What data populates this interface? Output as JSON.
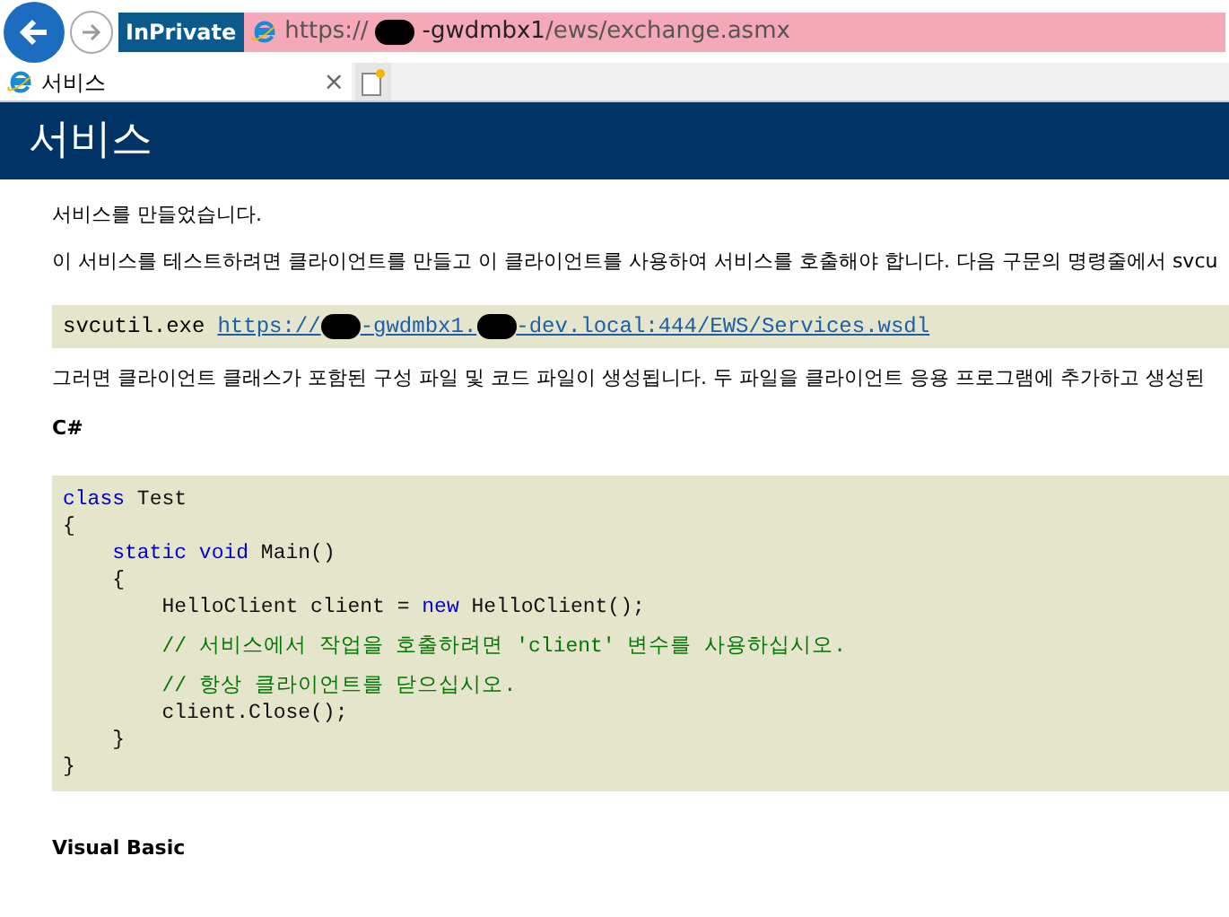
{
  "browser": {
    "inprivate_label": "InPrivate",
    "address": {
      "prefix": "https://",
      "suffix": "-gwdmbx1",
      "path": "/ews/exchange.asmx"
    },
    "tab": {
      "title": "서비스",
      "close": "×"
    }
  },
  "header": {
    "title": "서비스"
  },
  "intro": [
    "서비스를 만들었습니다.",
    "이 서비스를 테스트하려면 클라이언트를 만들고 이 클라이언트를 사용하여 서비스를 호출해야 합니다. 다음 구문의 명령줄에서 svcu"
  ],
  "command": {
    "program": "svcutil.exe",
    "link_parts": [
      "https://",
      "-gwdmbx1.",
      "-dev.local:444/EWS/Services.wsdl"
    ]
  },
  "after": "그러면 클라이언트 클래스가 포함된 구성 파일 및 코드 파일이 생성됩니다. 두 파일을 클라이언트 응용 프로그램에 추가하고 생성된",
  "csharp_heading": "C#",
  "code": [
    [
      {
        "kind": "keyword",
        "text": "class"
      },
      {
        "kind": "plain",
        "text": " Test"
      }
    ],
    [
      {
        "kind": "plain",
        "text": "{"
      }
    ],
    [
      {
        "kind": "keyword",
        "text": "    static"
      },
      {
        "kind": "keyword",
        "text": " void"
      },
      {
        "kind": "plain",
        "text": " Main()"
      }
    ],
    [
      {
        "kind": "plain",
        "text": "    {"
      }
    ],
    [
      {
        "kind": "plain",
        "text": "        HelloClient client = "
      },
      {
        "kind": "keyword",
        "text": "new"
      },
      {
        "kind": "plain",
        "text": " HelloClient();"
      }
    ],
    [
      {
        "kind": "comment",
        "text": "        // 서비스에서 작업을 호출하려면 'client' 변수를 사용하십시오."
      }
    ],
    [
      {
        "kind": "comment",
        "text": "        // 항상 클라이언트를 닫으십시오."
      }
    ],
    [
      {
        "kind": "plain",
        "text": "        client.Close();"
      }
    ],
    [
      {
        "kind": "plain",
        "text": "    }"
      }
    ],
    [
      {
        "kind": "plain",
        "text": "}"
      }
    ]
  ],
  "vb_heading": "Visual Basic"
}
